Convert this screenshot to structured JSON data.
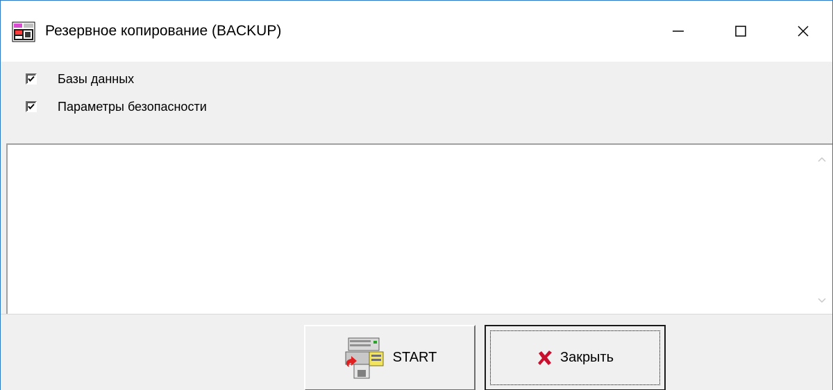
{
  "window": {
    "title": "Резервное копирование (BACKUP)",
    "icon": "backup-app-icon",
    "controls": {
      "minimize": "minimize-icon",
      "maximize": "maximize-icon",
      "close": "close-icon"
    }
  },
  "options": {
    "items": [
      {
        "label": "Базы данных",
        "checked": true
      },
      {
        "label": "Параметры безопасности",
        "checked": true
      }
    ]
  },
  "log": {
    "text": ""
  },
  "buttons": {
    "start_label": "START",
    "start_icon": "backup-start-icon",
    "close_label": "Закрыть",
    "close_icon": "red-x-icon"
  },
  "colors": {
    "window_border": "#2b79c7",
    "face": "#f0f0f0",
    "close_icon": "#c8102e"
  }
}
